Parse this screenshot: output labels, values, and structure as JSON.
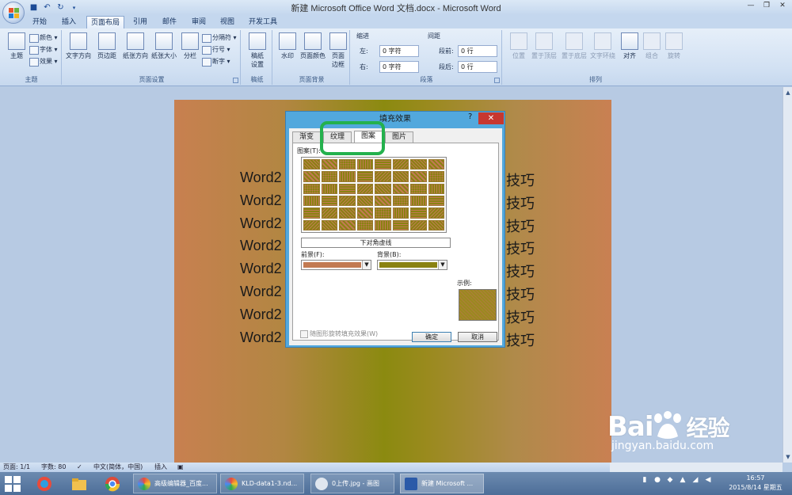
{
  "window": {
    "title": "新建 Microsoft Office Word 文档.docx - Microsoft Word",
    "controls": [
      "—",
      "❐",
      "✕"
    ]
  },
  "ribbon_tabs": [
    "开始",
    "插入",
    "页面布局",
    "引用",
    "邮件",
    "审阅",
    "视图",
    "开发工具"
  ],
  "active_tab": "页面布局",
  "ribbon": {
    "theme": {
      "big": "主题",
      "colors": "颜色 ▾",
      "fonts": "字体 ▾",
      "effects": "效果 ▾",
      "label": "主题"
    },
    "page_setup": {
      "text_direction": "文字方向",
      "margins": "页边距",
      "orientation": "纸张方向",
      "size": "纸张大小",
      "columns": "分栏",
      "breaks": "分隔符 ▾",
      "line_numbers": "行号 ▾",
      "hyphenation": "断字 ▾",
      "label": "页面设置"
    },
    "draft_paper": {
      "btn_line1": "稿纸",
      "btn_line2": "设置",
      "label": "稿纸"
    },
    "page_background": {
      "watermark": "水印",
      "page_color": "页面颜色",
      "borders_line1": "页面",
      "borders_line2": "边框",
      "label": "页面背景"
    },
    "paragraph": {
      "indent_title": "缩进",
      "left_label": "左:",
      "left_value": "0 字符",
      "right_label": "右:",
      "right_value": "0 字符",
      "spacing_title": "间距",
      "before_label": "段前:",
      "before_value": "0 行",
      "after_label": "段后:",
      "after_value": "0 行",
      "label": "段落"
    },
    "arrange": {
      "position": "位置",
      "bring_front": "置于顶层",
      "send_back": "置于底层",
      "wrap": "文字环绕",
      "align": "对齐",
      "group": "组合",
      "rotate": "旋转",
      "label": "排列"
    }
  },
  "document": {
    "lines_left": [
      "Word2",
      "Word2",
      "Word2",
      "Word2",
      "Word2",
      "Word2",
      "Word2",
      "Word2"
    ],
    "lines_right": [
      "技巧",
      "技巧",
      "技巧",
      "技巧",
      "技巧",
      "技巧",
      "技巧",
      "技巧"
    ]
  },
  "dialog": {
    "title": "填充效果",
    "help": "?",
    "close": "✕",
    "tabs": [
      "渐变",
      "纹理",
      "图案",
      "图片"
    ],
    "active_tab": "图案",
    "pattern_label": "图案(T):",
    "selected_pattern": "下对角虚线",
    "foreground_label": "前景(F):",
    "background_label": "背景(B):",
    "foreground_color": "#c27a52",
    "background_color": "#8a8212",
    "sample_label": "示例:",
    "rotate_checkbox": "随图形旋转填充效果(W)",
    "ok": "确定",
    "cancel": "取消"
  },
  "statusbar": {
    "page": "页面: 1/1",
    "words": "字数: 80",
    "language": "中文(简体，中国)",
    "mode": "插入"
  },
  "taskbar": {
    "items": [
      "高级编辑器_百度...",
      "KLD-data1-3.nd...",
      "0上传.jpg - 画图",
      "新建 Microsoft ..."
    ],
    "time": "16:57",
    "date": "2015/8/14 星期五"
  },
  "watermark": {
    "main": "Bai",
    "main2": "经验",
    "sub": "jingyan.baidu.com"
  }
}
